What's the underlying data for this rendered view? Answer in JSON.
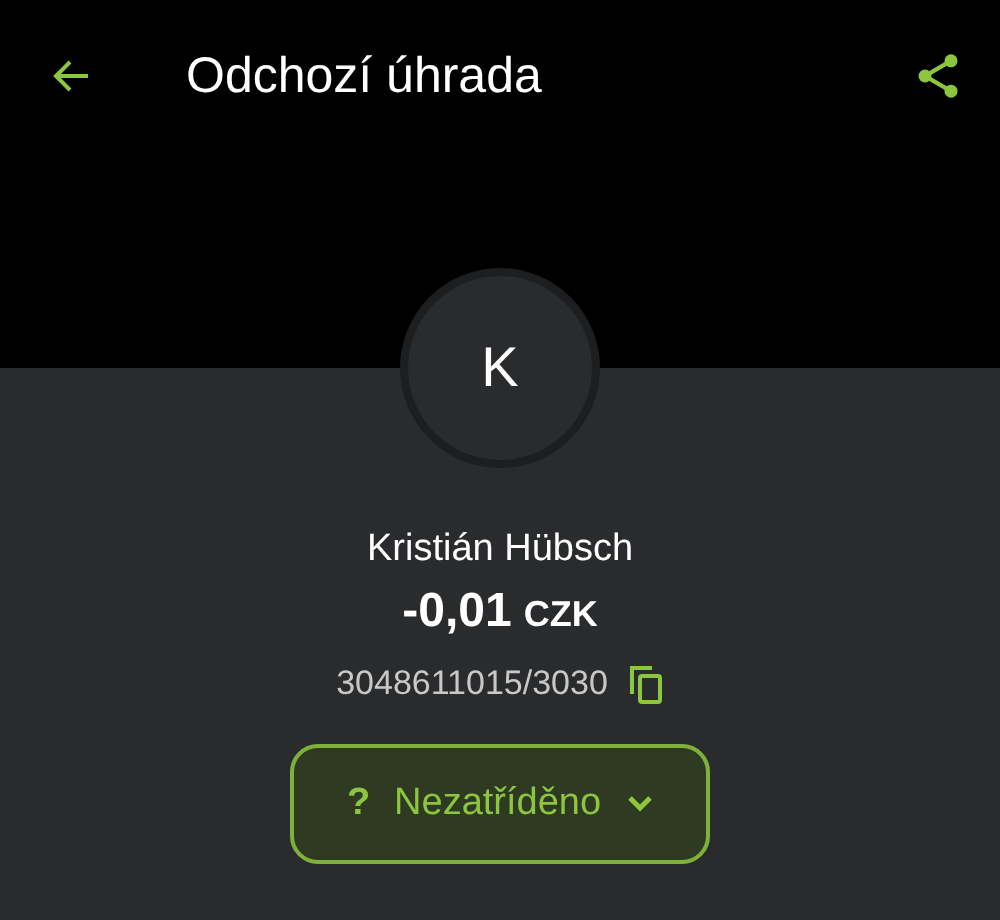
{
  "header": {
    "title": "Odchozí úhrada"
  },
  "avatar": {
    "initial": "K"
  },
  "counterparty": {
    "name": "Kristián Hübsch",
    "amount": "-0,01",
    "currency": "CZK",
    "account": "3048611015/3030"
  },
  "category": {
    "icon": "?",
    "label": "Nezatříděno"
  }
}
